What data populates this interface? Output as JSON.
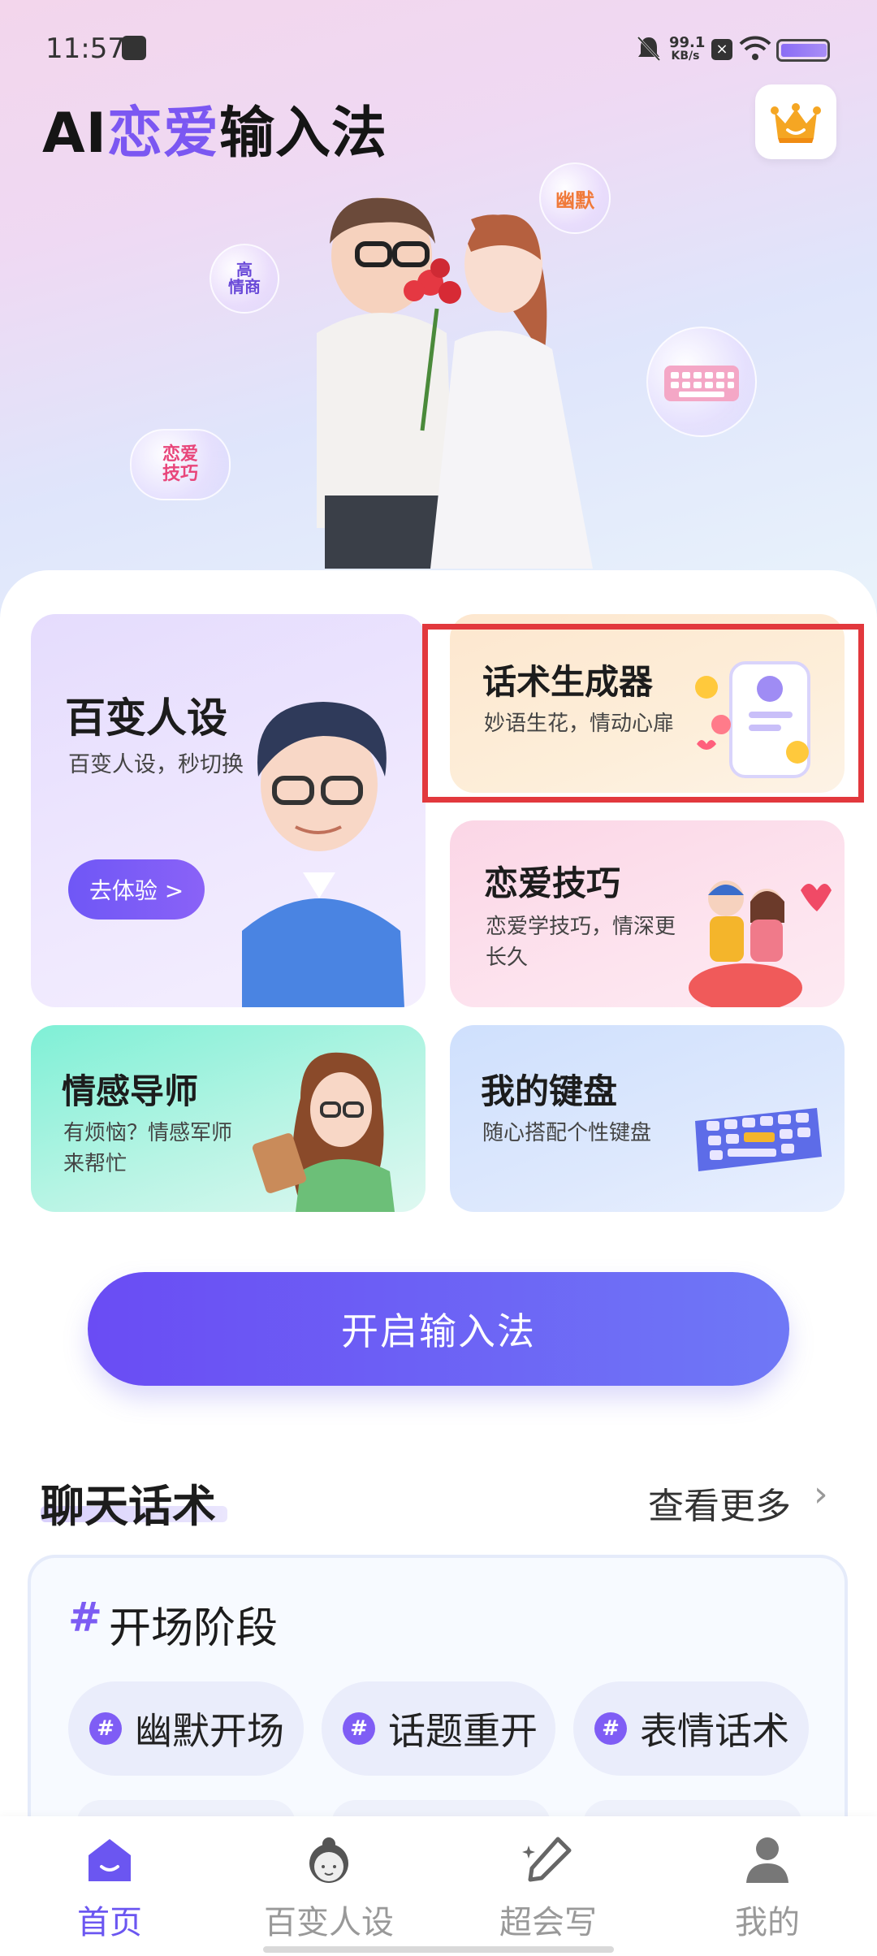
{
  "status_bar": {
    "time": "11:57",
    "speed_top": "99.1",
    "speed_unit": "KB/s"
  },
  "header": {
    "title_prefix": "AI",
    "title_accent": "恋爱",
    "title_suffix": "输入法",
    "crown_icon": "crown-icon"
  },
  "hero": {
    "bubbles": [
      "幽默",
      "高情商",
      "恋爱技巧"
    ],
    "bubble_high_1": "高",
    "bubble_high_2": "情商",
    "bubble_love_1": "恋爱",
    "bubble_love_2": "技巧"
  },
  "cards": {
    "persona": {
      "title": "百变人设",
      "subtitle": "百变人设，秒切换",
      "button": "去体验 >"
    },
    "generator": {
      "title": "话术生成器",
      "subtitle": "妙语生花，情动心扉"
    },
    "love_tips": {
      "title": "恋爱技巧",
      "subtitle_1": "恋爱学技巧，情深更",
      "subtitle_2": "长久"
    },
    "mentor": {
      "title": "情感导师",
      "subtitle_1": "有烦恼？情感军师",
      "subtitle_2": "来帮忙"
    },
    "keyboard": {
      "title": "我的键盘",
      "subtitle": "随心搭配个性键盘"
    }
  },
  "start_button": "开启输入法",
  "chat_section": {
    "title": "聊天话术",
    "see_more": "查看更多",
    "stage_hash": "#",
    "stage_title": "开场阶段",
    "chips": [
      {
        "hash": "#",
        "label": "幽默开场"
      },
      {
        "hash": "#",
        "label": "话题重开"
      },
      {
        "hash": "#",
        "label": "表情话术"
      }
    ]
  },
  "bottom_nav": [
    {
      "label": "首页",
      "icon": "home-icon",
      "active": true
    },
    {
      "label": "百变人设",
      "icon": "persona-icon",
      "active": false
    },
    {
      "label": "超会写",
      "icon": "pen-icon",
      "active": false
    },
    {
      "label": "我的",
      "icon": "profile-icon",
      "active": false
    }
  ],
  "colors": {
    "accent": "#7b57f2",
    "highlight": "#e2383d"
  }
}
